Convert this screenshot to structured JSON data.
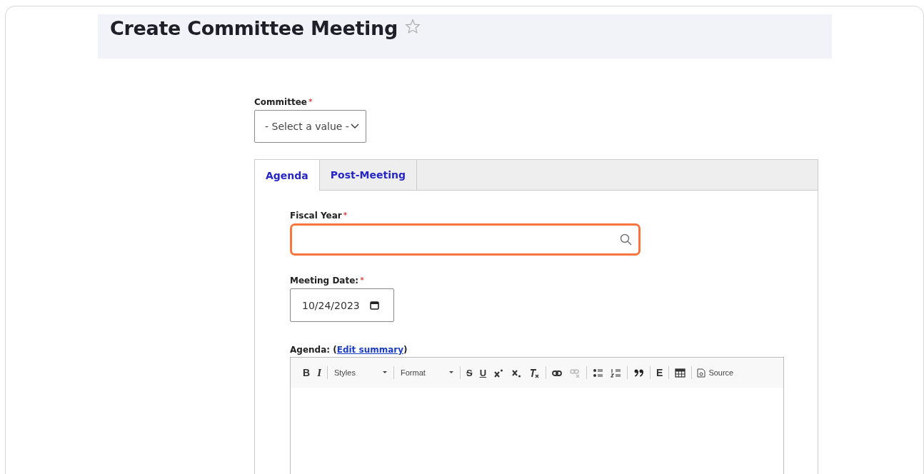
{
  "page": {
    "title": "Create Committee Meeting",
    "favorite": false
  },
  "committee": {
    "label": "Committee",
    "required_mark": "*",
    "value": "- Select a value -"
  },
  "tabs": [
    {
      "label": "Agenda",
      "selected": true
    },
    {
      "label": "Post-Meeting",
      "selected": false
    }
  ],
  "fiscal_year": {
    "label": "Fiscal Year",
    "required_mark": "*",
    "focused": true
  },
  "meeting_date": {
    "label": "Meeting Date:",
    "required_mark": "*",
    "value": "10/24/2023"
  },
  "agenda": {
    "label": "Agenda: (",
    "link": "Edit summary",
    "label_end": ")",
    "toolbar": [
      {
        "kind": "text",
        "label": "B"
      },
      {
        "kind": "text",
        "label": "I"
      },
      {
        "kind": "separator"
      },
      {
        "kind": "dropdown",
        "label": "Styles"
      },
      {
        "kind": "separator"
      },
      {
        "kind": "dropdown",
        "label": "Format"
      },
      {
        "kind": "separator"
      },
      {
        "kind": "text",
        "label": "S"
      },
      {
        "kind": "text",
        "label": "U"
      },
      {
        "kind": "icon",
        "disabled": false
      },
      {
        "kind": "icon",
        "disabled": false
      },
      {
        "kind": "icon",
        "disabled": false
      },
      {
        "kind": "separator"
      },
      {
        "kind": "icon",
        "disabled": false
      },
      {
        "kind": "icon",
        "disabled": true
      },
      {
        "kind": "separator"
      },
      {
        "kind": "icon",
        "disabled": false
      },
      {
        "kind": "icon",
        "disabled": false
      },
      {
        "kind": "separator"
      },
      {
        "kind": "icon",
        "disabled": false
      },
      {
        "kind": "separator"
      },
      {
        "kind": "text",
        "label": "E"
      },
      {
        "kind": "separator"
      },
      {
        "kind": "icon",
        "disabled": false
      },
      {
        "kind": "separator"
      },
      {
        "kind": "source",
        "label": "Source"
      }
    ]
  }
}
